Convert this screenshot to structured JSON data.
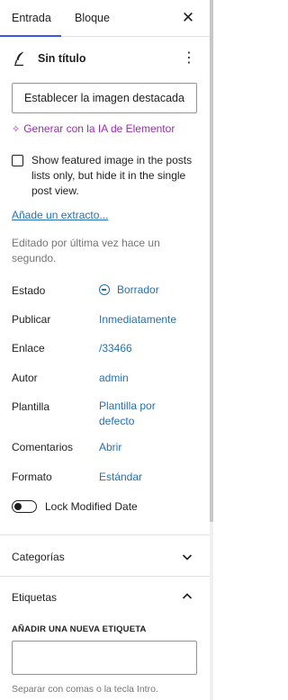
{
  "tabs": {
    "entrada": "Entrada",
    "bloque": "Bloque",
    "active": "Entrada"
  },
  "post": {
    "title": "Sin título"
  },
  "featured_image": {
    "button_label": "Establecer la imagen destacada"
  },
  "ai": {
    "generate_label": "Generar con la IA de Elementor"
  },
  "featured_option": {
    "label": "Show featured image in the posts lists only, but hide it in the single post view.",
    "checked": false
  },
  "excerpt": {
    "link": "Añade un extracto..."
  },
  "edited": {
    "text": "Editado por última vez hace un segundo."
  },
  "summary": [
    {
      "label": "Estado",
      "value": "Borrador"
    },
    {
      "label": "Publicar",
      "value": "Inmediatamente"
    },
    {
      "label": "Enlace",
      "value": "/33466"
    },
    {
      "label": "Autor",
      "value": "admin"
    },
    {
      "label": "Plantilla",
      "value": "Plantilla por defecto"
    },
    {
      "label": "Comentarios",
      "value": "Abrir"
    },
    {
      "label": "Formato",
      "value": "Estándar"
    }
  ],
  "lock": {
    "label": "Lock Modified Date",
    "enabled": false
  },
  "sections": {
    "categorias": {
      "title": "Categorías",
      "expanded": false
    },
    "etiquetas": {
      "title": "Etiquetas",
      "expanded": true
    }
  },
  "tags": {
    "add_heading": "AÑADIR UNA NUEVA ETIQUETA",
    "input_value": "",
    "help": "Separar con comas o la tecla Intro."
  },
  "colors": {
    "accent": "#3858e9",
    "link": "#2271b1",
    "ai": "#9b2bb0",
    "muted": "#757575"
  },
  "icons": {
    "close": "close-icon",
    "post": "feather-icon",
    "more": "kebab-icon",
    "ai": "sparkle-icon",
    "status": "draft-status-icon",
    "collapse": "chevron-down-icon",
    "expand": "chevron-up-icon"
  }
}
